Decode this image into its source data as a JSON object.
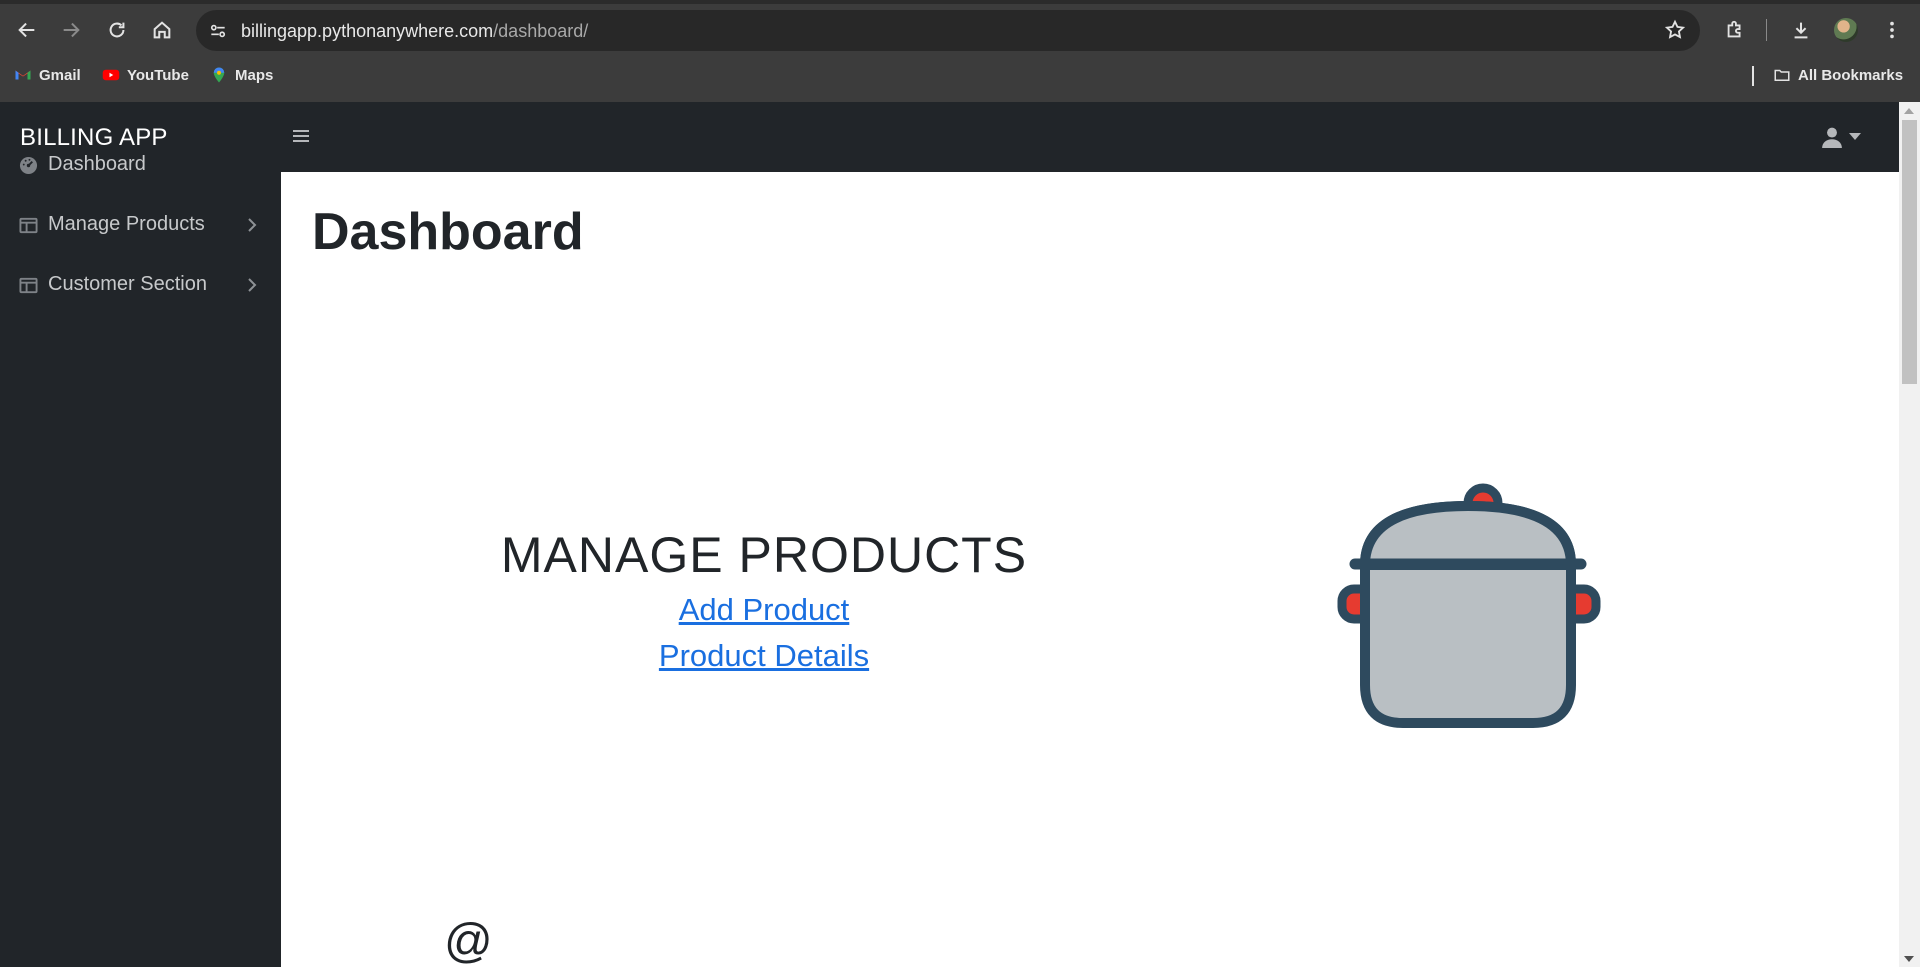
{
  "browser": {
    "url_host": "billingapp.pythonanywhere.com",
    "url_path": "/dashboard/",
    "bookmarks": [
      {
        "label": "Gmail",
        "icon": "gmail-icon"
      },
      {
        "label": "YouTube",
        "icon": "youtube-icon"
      },
      {
        "label": "Maps",
        "icon": "maps-icon"
      }
    ],
    "all_bookmarks_label": "All Bookmarks"
  },
  "app": {
    "brand": "BILLING APP",
    "sidebar": {
      "items": [
        {
          "label": "Dashboard",
          "icon": "dashboard-icon"
        },
        {
          "label": "Manage Products",
          "icon": "table-icon"
        },
        {
          "label": "Customer Section",
          "icon": "table-icon"
        }
      ]
    },
    "page_title": "Dashboard",
    "manage_products": {
      "title": "MANAGE PRODUCTS",
      "links": [
        "Add Product",
        "Product Details"
      ]
    },
    "next_section_glyph": "@"
  },
  "colors": {
    "sidebar_bg": "#212529",
    "link": "#1a6fe0",
    "pot_outline": "#2e4a5e",
    "pot_body": "#b9bfc3",
    "pot_accent": "#e63b30"
  }
}
